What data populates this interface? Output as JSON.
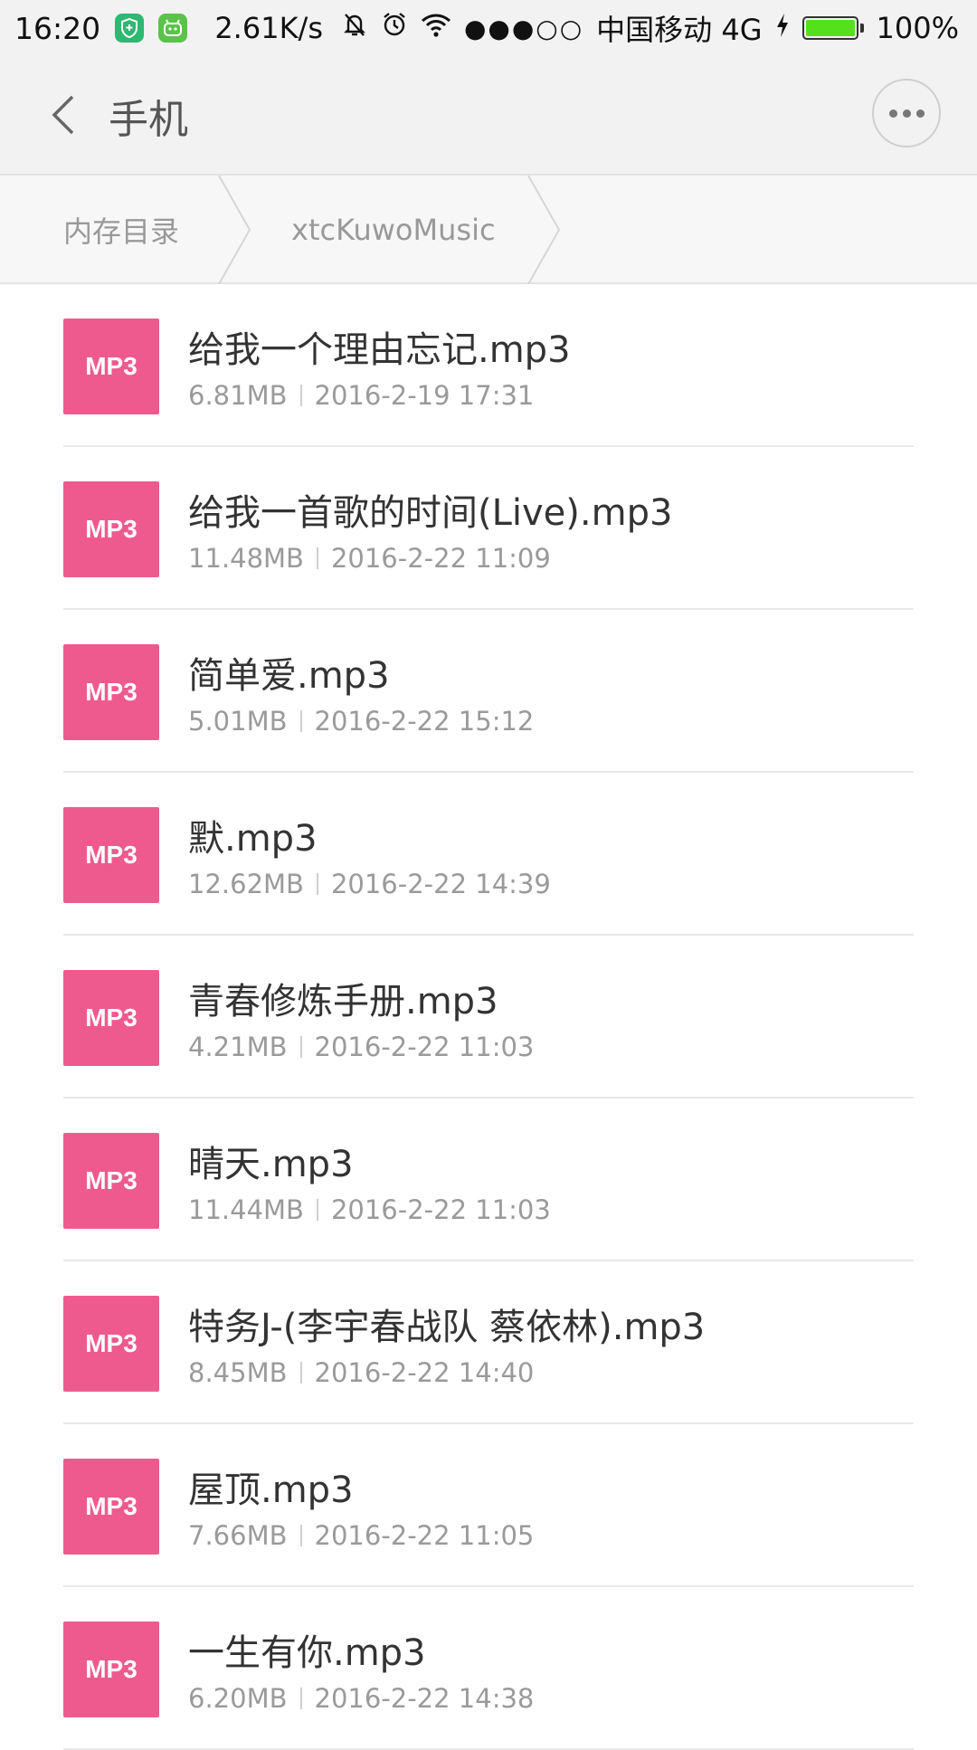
{
  "status_bar": {
    "time": "16:20",
    "net_speed": "2.61K/s",
    "signal_dots": "●●●○○",
    "carrier": "中国移动 4G",
    "battery": "100%",
    "battery_level": 1.0,
    "icons": [
      "shield-app-icon",
      "android-app-icon",
      "mute-bell-icon",
      "alarm-icon",
      "wifi-icon",
      "charging-icon",
      "battery-icon"
    ]
  },
  "header": {
    "title": "手机",
    "back_icon": "chevron-left-icon",
    "more_icon": "more-dots-icon"
  },
  "breadcrumb": {
    "items": [
      "内存目录",
      "xtcKuwoMusic"
    ]
  },
  "files": [
    {
      "icon_label": "MP3",
      "name": "给我一个理由忘记.mp3",
      "size": "6.81MB",
      "date": "2016-2-19 17:31"
    },
    {
      "icon_label": "MP3",
      "name": "给我一首歌的时间(Live).mp3",
      "size": "11.48MB",
      "date": "2016-2-22 11:09"
    },
    {
      "icon_label": "MP3",
      "name": "简单爱.mp3",
      "size": "5.01MB",
      "date": "2016-2-22 15:12"
    },
    {
      "icon_label": "MP3",
      "name": "默.mp3",
      "size": "12.62MB",
      "date": "2016-2-22 14:39"
    },
    {
      "icon_label": "MP3",
      "name": "青春修炼手册.mp3",
      "size": "4.21MB",
      "date": "2016-2-22 11:03"
    },
    {
      "icon_label": "MP3",
      "name": "晴天.mp3",
      "size": "11.44MB",
      "date": "2016-2-22 11:03"
    },
    {
      "icon_label": "MP3",
      "name": "特务J-(李宇春战队 蔡依林).mp3",
      "size": "8.45MB",
      "date": "2016-2-22 14:40"
    },
    {
      "icon_label": "MP3",
      "name": "屋顶.mp3",
      "size": "7.66MB",
      "date": "2016-2-22 11:05"
    },
    {
      "icon_label": "MP3",
      "name": "一生有你.mp3",
      "size": "6.20MB",
      "date": "2016-2-22 14:38"
    }
  ],
  "colors": {
    "mp3_icon": "#ee5a8e",
    "header_bg": "#f2f2f2",
    "battery_fill": "#55e01c"
  }
}
